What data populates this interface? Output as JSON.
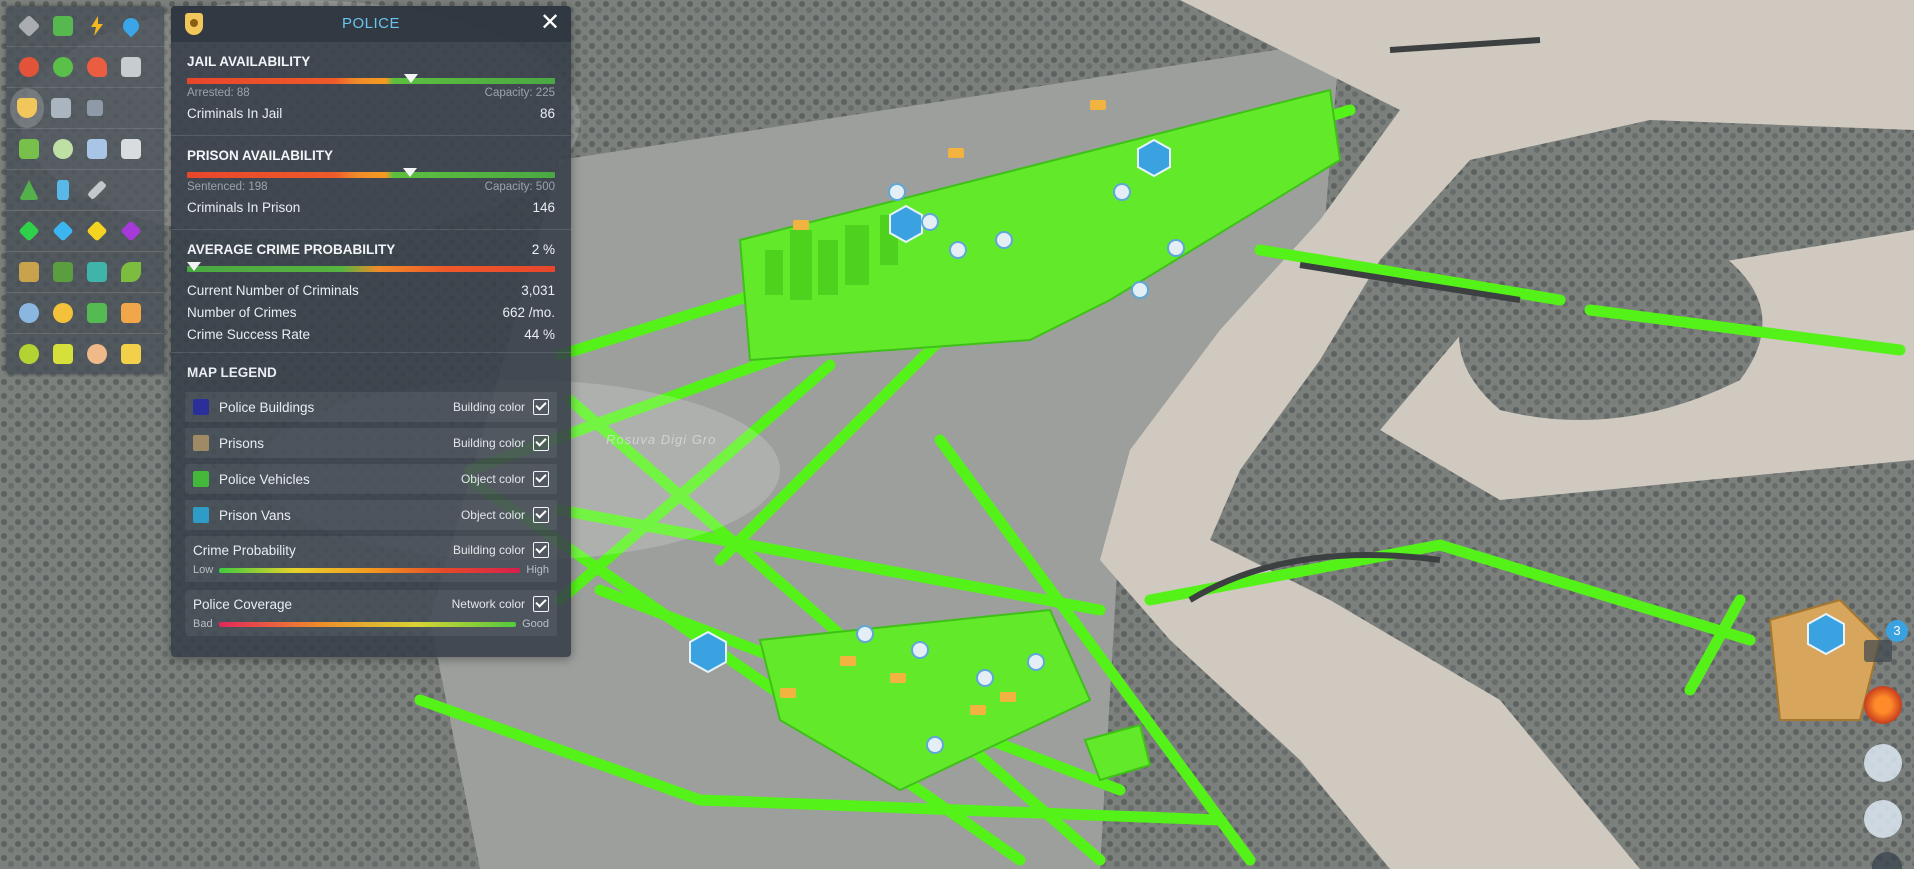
{
  "panel": {
    "title": "POLICE",
    "jail": {
      "title": "JAIL AVAILABILITY",
      "arrested": "Arrested: 88",
      "capacity": "Capacity: 225",
      "marker_fraction": 0.61,
      "row_label": "Criminals In Jail",
      "row_value": "86"
    },
    "prison": {
      "title": "PRISON AVAILABILITY",
      "sentenced": "Sentenced: 198",
      "capacity": "Capacity: 500",
      "marker_fraction": 0.605,
      "row_label": "Criminals In Prison",
      "row_value": "146"
    },
    "crime": {
      "title": "AVERAGE CRIME PROBABILITY",
      "percent": "2 %",
      "marker_fraction": 0.02,
      "rows": [
        {
          "label": "Current Number of Criminals",
          "value": "3,031"
        },
        {
          "label": "Number of Crimes",
          "value": "662 /mo."
        },
        {
          "label": "Crime Success Rate",
          "value": "44 %"
        }
      ]
    },
    "legend": {
      "title": "MAP LEGEND",
      "items": [
        {
          "label": "Police Buildings",
          "kind": "Building color",
          "color": "#2a2f9a"
        },
        {
          "label": "Prisons",
          "kind": "Building color",
          "color": "#a08a66"
        },
        {
          "label": "Police Vehicles",
          "kind": "Object color",
          "color": "#43b83a"
        },
        {
          "label": "Prison Vans",
          "kind": "Object color",
          "color": "#2f9cc8"
        }
      ],
      "crime_probability": {
        "label": "Crime Probability",
        "kind": "Building color",
        "low": "Low",
        "high": "High"
      },
      "police_coverage": {
        "label": "Police Coverage",
        "kind": "Network color",
        "low": "Bad",
        "high": "Good"
      }
    }
  },
  "map": {
    "district_label": "Rosuva Digi Gro"
  },
  "hud": {
    "notification_count": "3"
  },
  "colors": {
    "coverage_green": "#55f21a",
    "accent_blue": "#6bc4ef"
  }
}
